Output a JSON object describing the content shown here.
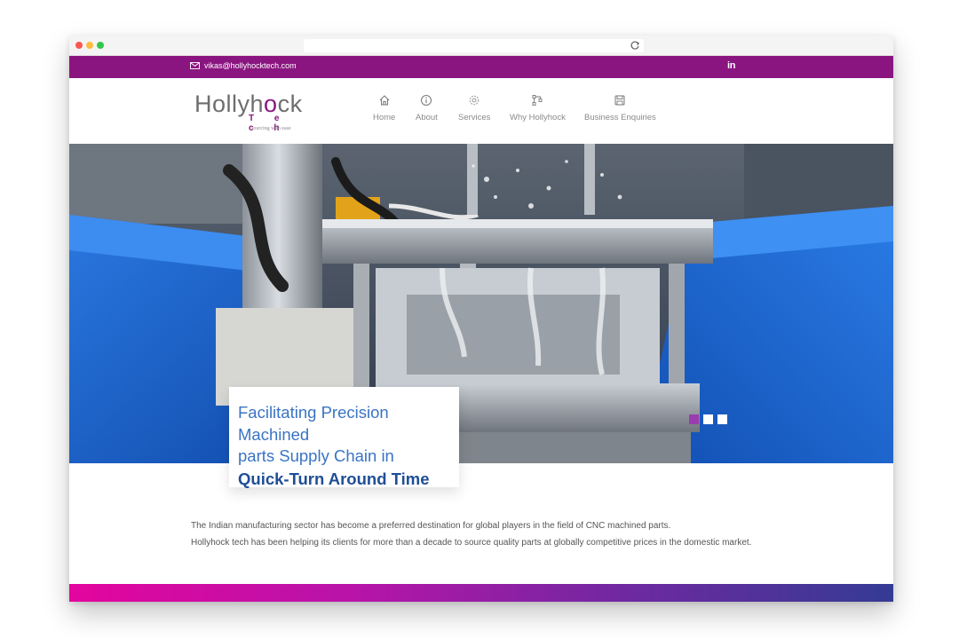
{
  "browser": {
    "url": ""
  },
  "topbar": {
    "email": "vikas@hollyhocktech.com",
    "social_label": "in",
    "icons": {
      "email": "mail-icon",
      "social": "linkedin-icon"
    }
  },
  "logo": {
    "word": "Hollyh",
    "word_o": "o",
    "word_end": "ck",
    "sub": "T e c h",
    "tagline": "sourcing with ease"
  },
  "nav": {
    "items": [
      {
        "label": "Home",
        "icon": "home-icon"
      },
      {
        "label": "About",
        "icon": "info-icon"
      },
      {
        "label": "Services",
        "icon": "gear-icon"
      },
      {
        "label": "Why Hollyhock",
        "icon": "flow-icon"
      },
      {
        "label": "Business Enquiries",
        "icon": "save-icon"
      }
    ]
  },
  "hero": {
    "caption_line1": "Facilitating Precision Machined",
    "caption_line2": "parts Supply Chain in",
    "caption_bold": "Quick-Turn Around Time",
    "slides": {
      "count": 3,
      "active": 1
    }
  },
  "intro": {
    "line1": "The Indian manufacturing sector has become a preferred destination for global players in the field of CNC machined parts.",
    "line2": "Hollyhock tech has been helping its clients for more than a decade to source quality parts at globally competitive prices in the domestic market."
  },
  "colors": {
    "brand_purple": "#8a1580",
    "caption_blue": "#3a74c4",
    "caption_bold_blue": "#1f4e96",
    "footer_gradient_start": "#e3059e",
    "footer_gradient_end": "#343b93"
  }
}
